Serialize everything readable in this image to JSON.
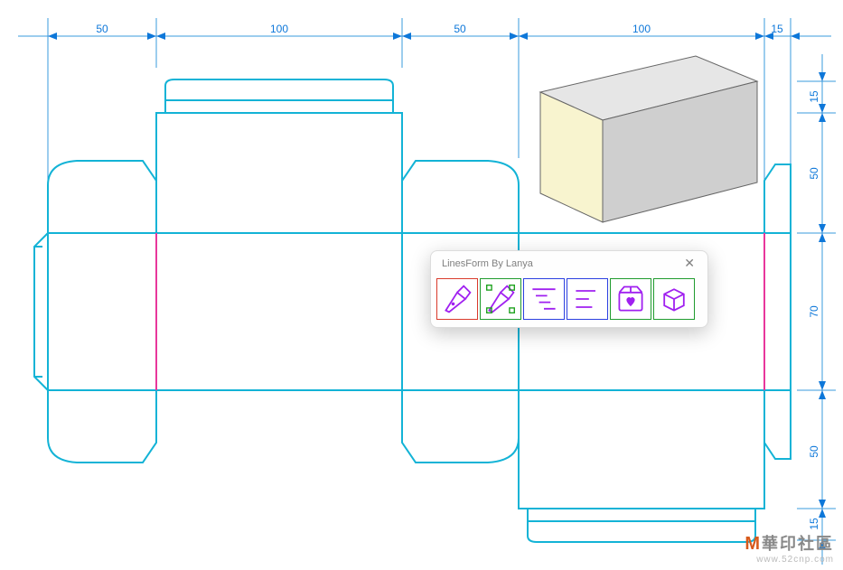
{
  "toolbar": {
    "title": "LinesForm By Lanya",
    "buttons": [
      {
        "name": "pen-tool-icon",
        "border": "red"
      },
      {
        "name": "pen-select-icon",
        "border": "green"
      },
      {
        "name": "stairs-lines-icon",
        "border": "blue"
      },
      {
        "name": "align-lines-icon",
        "border": "blue"
      },
      {
        "name": "box-heart-icon",
        "border": "green"
      },
      {
        "name": "box-3d-icon",
        "border": "green"
      }
    ]
  },
  "dimensions": {
    "top": [
      {
        "label": "50",
        "from": 53,
        "to": 173
      },
      {
        "label": "100",
        "from": 173,
        "to": 445
      },
      {
        "label": "50",
        "from": 445,
        "to": 574
      },
      {
        "label": "100",
        "from": 574,
        "to": 846
      },
      {
        "label": "15",
        "from": 846,
        "to": 875
      }
    ],
    "right": [
      {
        "label": "15",
        "from": 90,
        "to": 125
      },
      {
        "label": "50",
        "from": 125,
        "to": 258
      },
      {
        "label": "70",
        "from": 258,
        "to": 432
      },
      {
        "label": "50",
        "from": 432,
        "to": 563
      },
      {
        "label": "15",
        "from": 563,
        "to": 598
      }
    ],
    "units": "mm"
  },
  "dieline": {
    "panels": {
      "width": 50,
      "length": 100,
      "depth": 70,
      "glue_flap": 15,
      "tuck": 15
    },
    "fold_x": [
      173,
      445,
      574,
      846
    ],
    "body_y": [
      258,
      432
    ]
  },
  "preview_box": {
    "present": true,
    "face_color": "#f8f4cf",
    "top_color": "#e6e6e6",
    "side_color": "#cfcfcf"
  },
  "watermark": {
    "line1_accent": "M",
    "line1_rest": "華印社區",
    "line2": "www.52cnp.com"
  }
}
